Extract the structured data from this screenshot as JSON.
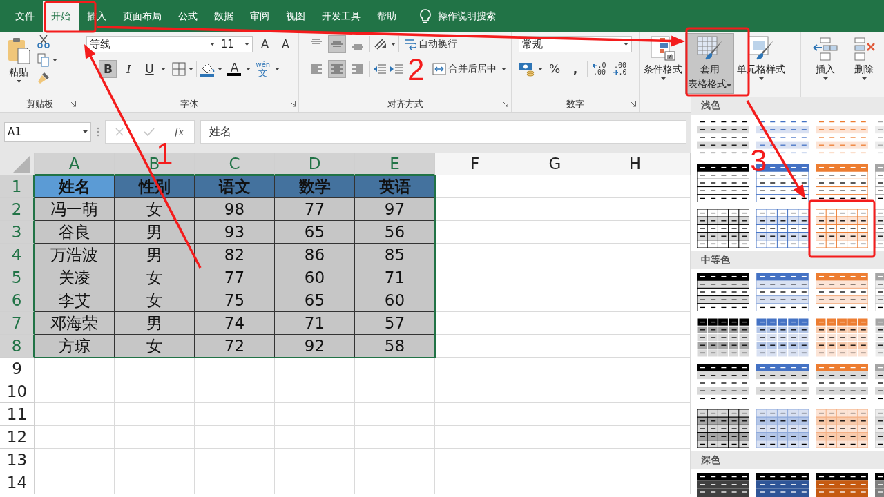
{
  "tabs": [
    {
      "label": "文件",
      "selected": false
    },
    {
      "label": "开始",
      "selected": true
    },
    {
      "label": "插入",
      "selected": false
    },
    {
      "label": "页面布局",
      "selected": false
    },
    {
      "label": "公式",
      "selected": false
    },
    {
      "label": "数据",
      "selected": false
    },
    {
      "label": "审阅",
      "selected": false
    },
    {
      "label": "视图",
      "selected": false
    },
    {
      "label": "开发工具",
      "selected": false
    },
    {
      "label": "帮助",
      "selected": false
    }
  ],
  "tell_me": {
    "placeholder": "操作说明搜索"
  },
  "ribbon": {
    "clipboard": {
      "paste": "粘贴",
      "label": "剪贴板"
    },
    "font": {
      "name": "等线",
      "size": "11",
      "grow": "A",
      "shrink": "A",
      "font_color": "A",
      "phonetic": [
        "wén",
        "文"
      ],
      "label": "字体",
      "toggles": [
        {
          "kind": "bold",
          "glyph": "B",
          "pressed": true
        },
        {
          "kind": "italic",
          "glyph": "I",
          "pressed": false
        },
        {
          "kind": "underline",
          "glyph": "U",
          "pressed": false
        }
      ]
    },
    "alignment": {
      "wrap": "自动换行",
      "merge": "合并后居中",
      "label": "对齐方式",
      "vertical": [
        {
          "kind": "top",
          "pressed": false
        },
        {
          "kind": "middle",
          "pressed": true
        },
        {
          "kind": "bottom",
          "pressed": false
        }
      ],
      "horizontal": [
        {
          "kind": "left",
          "pressed": false
        },
        {
          "kind": "center",
          "pressed": true
        },
        {
          "kind": "right",
          "pressed": false
        }
      ]
    },
    "number": {
      "format": "常规",
      "percent": "%",
      "comma": ",",
      "label": "数字",
      "decimals": [
        {
          "kind": "increase",
          "top": ".0",
          "bottom": ".00"
        },
        {
          "kind": "decrease",
          "top": ".00",
          "bottom": ".0"
        }
      ]
    },
    "styles": [
      {
        "kind": "conditional",
        "lines": [
          "条件格式"
        ],
        "pressed": false
      },
      {
        "kind": "table",
        "lines": [
          "套用",
          "表格格式"
        ],
        "pressed": true
      },
      {
        "kind": "cell",
        "lines": [
          "单元格样式"
        ],
        "pressed": false
      }
    ],
    "cells": [
      {
        "kind": "insert",
        "label": "插入"
      },
      {
        "kind": "delete",
        "label": "删除"
      }
    ]
  },
  "formula_bar": {
    "name_box": "A1",
    "fx": "fx",
    "value": "姓名"
  },
  "sheet": {
    "columns": [
      {
        "label": "A",
        "selected": true
      },
      {
        "label": "B",
        "selected": true
      },
      {
        "label": "C",
        "selected": true
      },
      {
        "label": "D",
        "selected": true
      },
      {
        "label": "E",
        "selected": true
      },
      {
        "label": "F",
        "selected": false
      },
      {
        "label": "G",
        "selected": false
      },
      {
        "label": "H",
        "selected": false
      }
    ],
    "rows": [
      {
        "number": "1",
        "kind": "header",
        "selected": true,
        "cells": [
          "姓名",
          "性别",
          "语文",
          "数学",
          "英语"
        ]
      },
      {
        "number": "2",
        "kind": "data",
        "selected": true,
        "cells": [
          "冯一萌",
          "女",
          "98",
          "77",
          "97"
        ]
      },
      {
        "number": "3",
        "kind": "data",
        "selected": true,
        "cells": [
          "谷良",
          "男",
          "93",
          "65",
          "56"
        ]
      },
      {
        "number": "4",
        "kind": "data",
        "selected": true,
        "cells": [
          "万浩波",
          "男",
          "82",
          "86",
          "85"
        ]
      },
      {
        "number": "5",
        "kind": "data",
        "selected": true,
        "cells": [
          "关凌",
          "女",
          "77",
          "60",
          "71"
        ]
      },
      {
        "number": "6",
        "kind": "data",
        "selected": true,
        "cells": [
          "李艾",
          "女",
          "75",
          "65",
          "60"
        ]
      },
      {
        "number": "7",
        "kind": "data",
        "selected": true,
        "cells": [
          "邓海荣",
          "男",
          "74",
          "71",
          "57"
        ]
      },
      {
        "number": "8",
        "kind": "data",
        "selected": true,
        "cells": [
          "方琼",
          "女",
          "72",
          "92",
          "58"
        ]
      },
      {
        "number": "9",
        "kind": "empty",
        "selected": false
      },
      {
        "number": "10",
        "kind": "empty",
        "selected": false
      },
      {
        "number": "11",
        "kind": "empty",
        "selected": false
      },
      {
        "number": "12",
        "kind": "empty",
        "selected": false
      },
      {
        "number": "13",
        "kind": "empty",
        "selected": false
      },
      {
        "number": "14",
        "kind": "empty",
        "selected": false
      }
    ]
  },
  "gallery": {
    "sections": [
      {
        "label": "浅色",
        "kind": "light"
      },
      {
        "label": "中等色",
        "kind": "medium"
      },
      {
        "label": "深色",
        "kind": "dark"
      }
    ]
  },
  "annotations": {
    "steps": [
      "1",
      "2",
      "3"
    ]
  }
}
